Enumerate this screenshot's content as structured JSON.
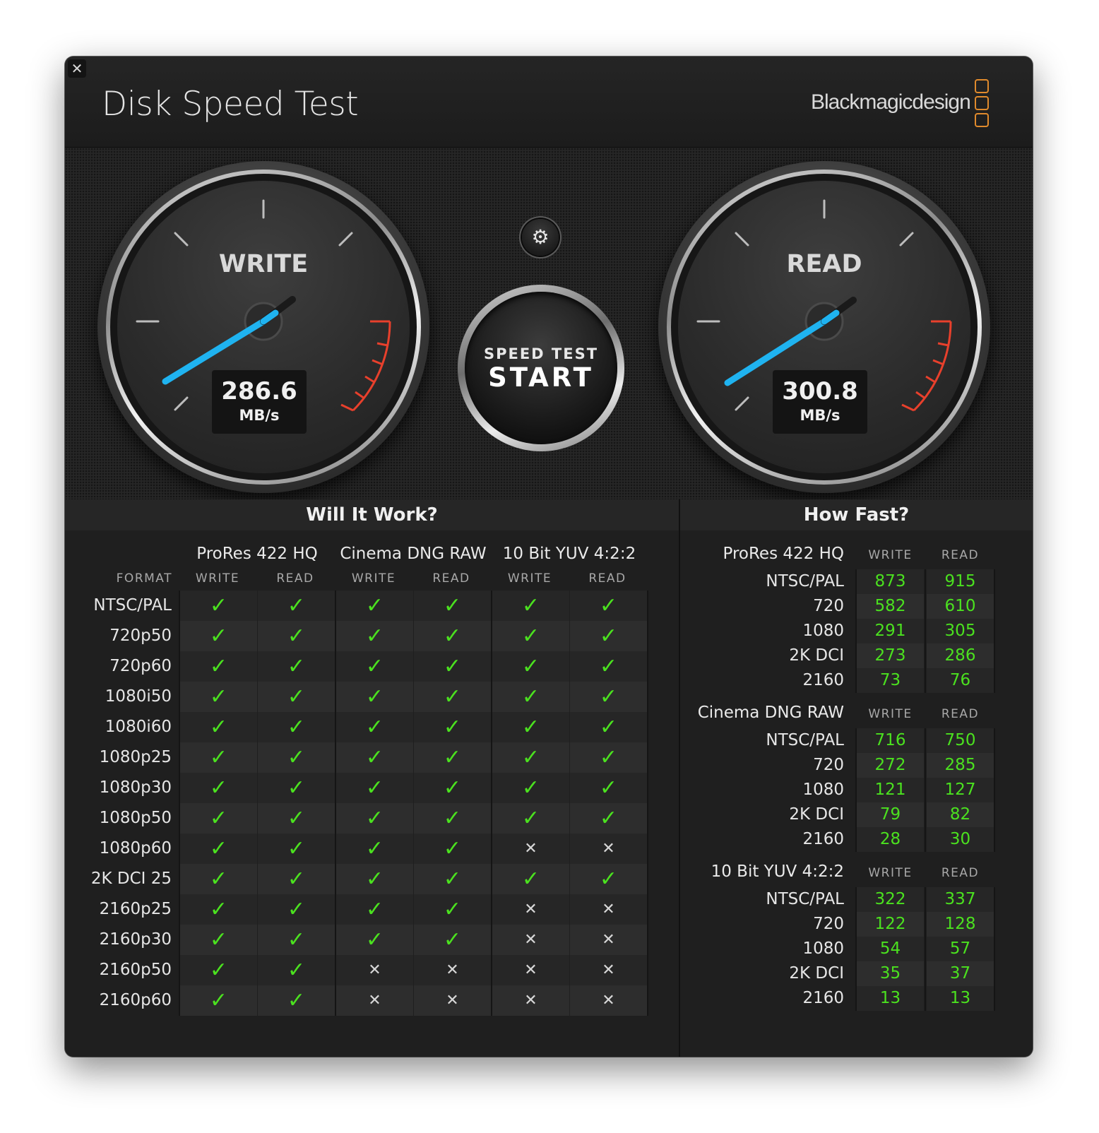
{
  "app": {
    "title": "Disk Speed Test",
    "brand": "Blackmagicdesign",
    "close_glyph": "✕"
  },
  "gauges": {
    "write": {
      "label": "WRITE",
      "value": "286.6",
      "unit": "MB/s"
    },
    "read": {
      "label": "READ",
      "value": "300.8",
      "unit": "MB/s"
    }
  },
  "controls": {
    "settings_icon": "gear-icon",
    "start_line1": "SPEED TEST",
    "start_line2": "START"
  },
  "will_it_work": {
    "title": "Will It Work?",
    "format_header": "FORMAT",
    "groups": [
      "ProRes 422 HQ",
      "Cinema DNG RAW",
      "10 Bit YUV 4:2:2"
    ],
    "subheaders": [
      "WRITE",
      "READ"
    ],
    "rows": [
      {
        "format": "NTSC/PAL",
        "cells": [
          1,
          1,
          1,
          1,
          1,
          1
        ]
      },
      {
        "format": "720p50",
        "cells": [
          1,
          1,
          1,
          1,
          1,
          1
        ]
      },
      {
        "format": "720p60",
        "cells": [
          1,
          1,
          1,
          1,
          1,
          1
        ]
      },
      {
        "format": "1080i50",
        "cells": [
          1,
          1,
          1,
          1,
          1,
          1
        ]
      },
      {
        "format": "1080i60",
        "cells": [
          1,
          1,
          1,
          1,
          1,
          1
        ]
      },
      {
        "format": "1080p25",
        "cells": [
          1,
          1,
          1,
          1,
          1,
          1
        ]
      },
      {
        "format": "1080p30",
        "cells": [
          1,
          1,
          1,
          1,
          1,
          1
        ]
      },
      {
        "format": "1080p50",
        "cells": [
          1,
          1,
          1,
          1,
          1,
          1
        ]
      },
      {
        "format": "1080p60",
        "cells": [
          1,
          1,
          1,
          1,
          0,
          0
        ]
      },
      {
        "format": "2K DCI 25",
        "cells": [
          1,
          1,
          1,
          1,
          1,
          1
        ]
      },
      {
        "format": "2160p25",
        "cells": [
          1,
          1,
          1,
          1,
          0,
          0
        ]
      },
      {
        "format": "2160p30",
        "cells": [
          1,
          1,
          1,
          1,
          0,
          0
        ]
      },
      {
        "format": "2160p50",
        "cells": [
          1,
          1,
          0,
          0,
          0,
          0
        ]
      },
      {
        "format": "2160p60",
        "cells": [
          1,
          1,
          0,
          0,
          0,
          0
        ]
      }
    ],
    "check_glyph": "✓",
    "cross_glyph": "✕"
  },
  "how_fast": {
    "title": "How Fast?",
    "subheaders": [
      "WRITE",
      "READ"
    ],
    "groups": [
      {
        "name": "ProRes 422 HQ",
        "rows": [
          {
            "label": "NTSC/PAL",
            "write": "873",
            "read": "915"
          },
          {
            "label": "720",
            "write": "582",
            "read": "610"
          },
          {
            "label": "1080",
            "write": "291",
            "read": "305"
          },
          {
            "label": "2K DCI",
            "write": "273",
            "read": "286"
          },
          {
            "label": "2160",
            "write": "73",
            "read": "76"
          }
        ]
      },
      {
        "name": "Cinema DNG RAW",
        "rows": [
          {
            "label": "NTSC/PAL",
            "write": "716",
            "read": "750"
          },
          {
            "label": "720",
            "write": "272",
            "read": "285"
          },
          {
            "label": "1080",
            "write": "121",
            "read": "127"
          },
          {
            "label": "2K DCI",
            "write": "79",
            "read": "82"
          },
          {
            "label": "2160",
            "write": "28",
            "read": "30"
          }
        ]
      },
      {
        "name": "10 Bit YUV 4:2:2",
        "rows": [
          {
            "label": "NTSC/PAL",
            "write": "322",
            "read": "337"
          },
          {
            "label": "720",
            "write": "122",
            "read": "128"
          },
          {
            "label": "1080",
            "write": "54",
            "read": "57"
          },
          {
            "label": "2K DCI",
            "write": "35",
            "read": "37"
          },
          {
            "label": "2160",
            "write": "13",
            "read": "13"
          }
        ]
      }
    ]
  },
  "colors": {
    "accent_needle": "#1fb3f0",
    "redline": "#e8402c",
    "ok_green": "#4be11f",
    "brand_orange": "#e08a2c"
  }
}
